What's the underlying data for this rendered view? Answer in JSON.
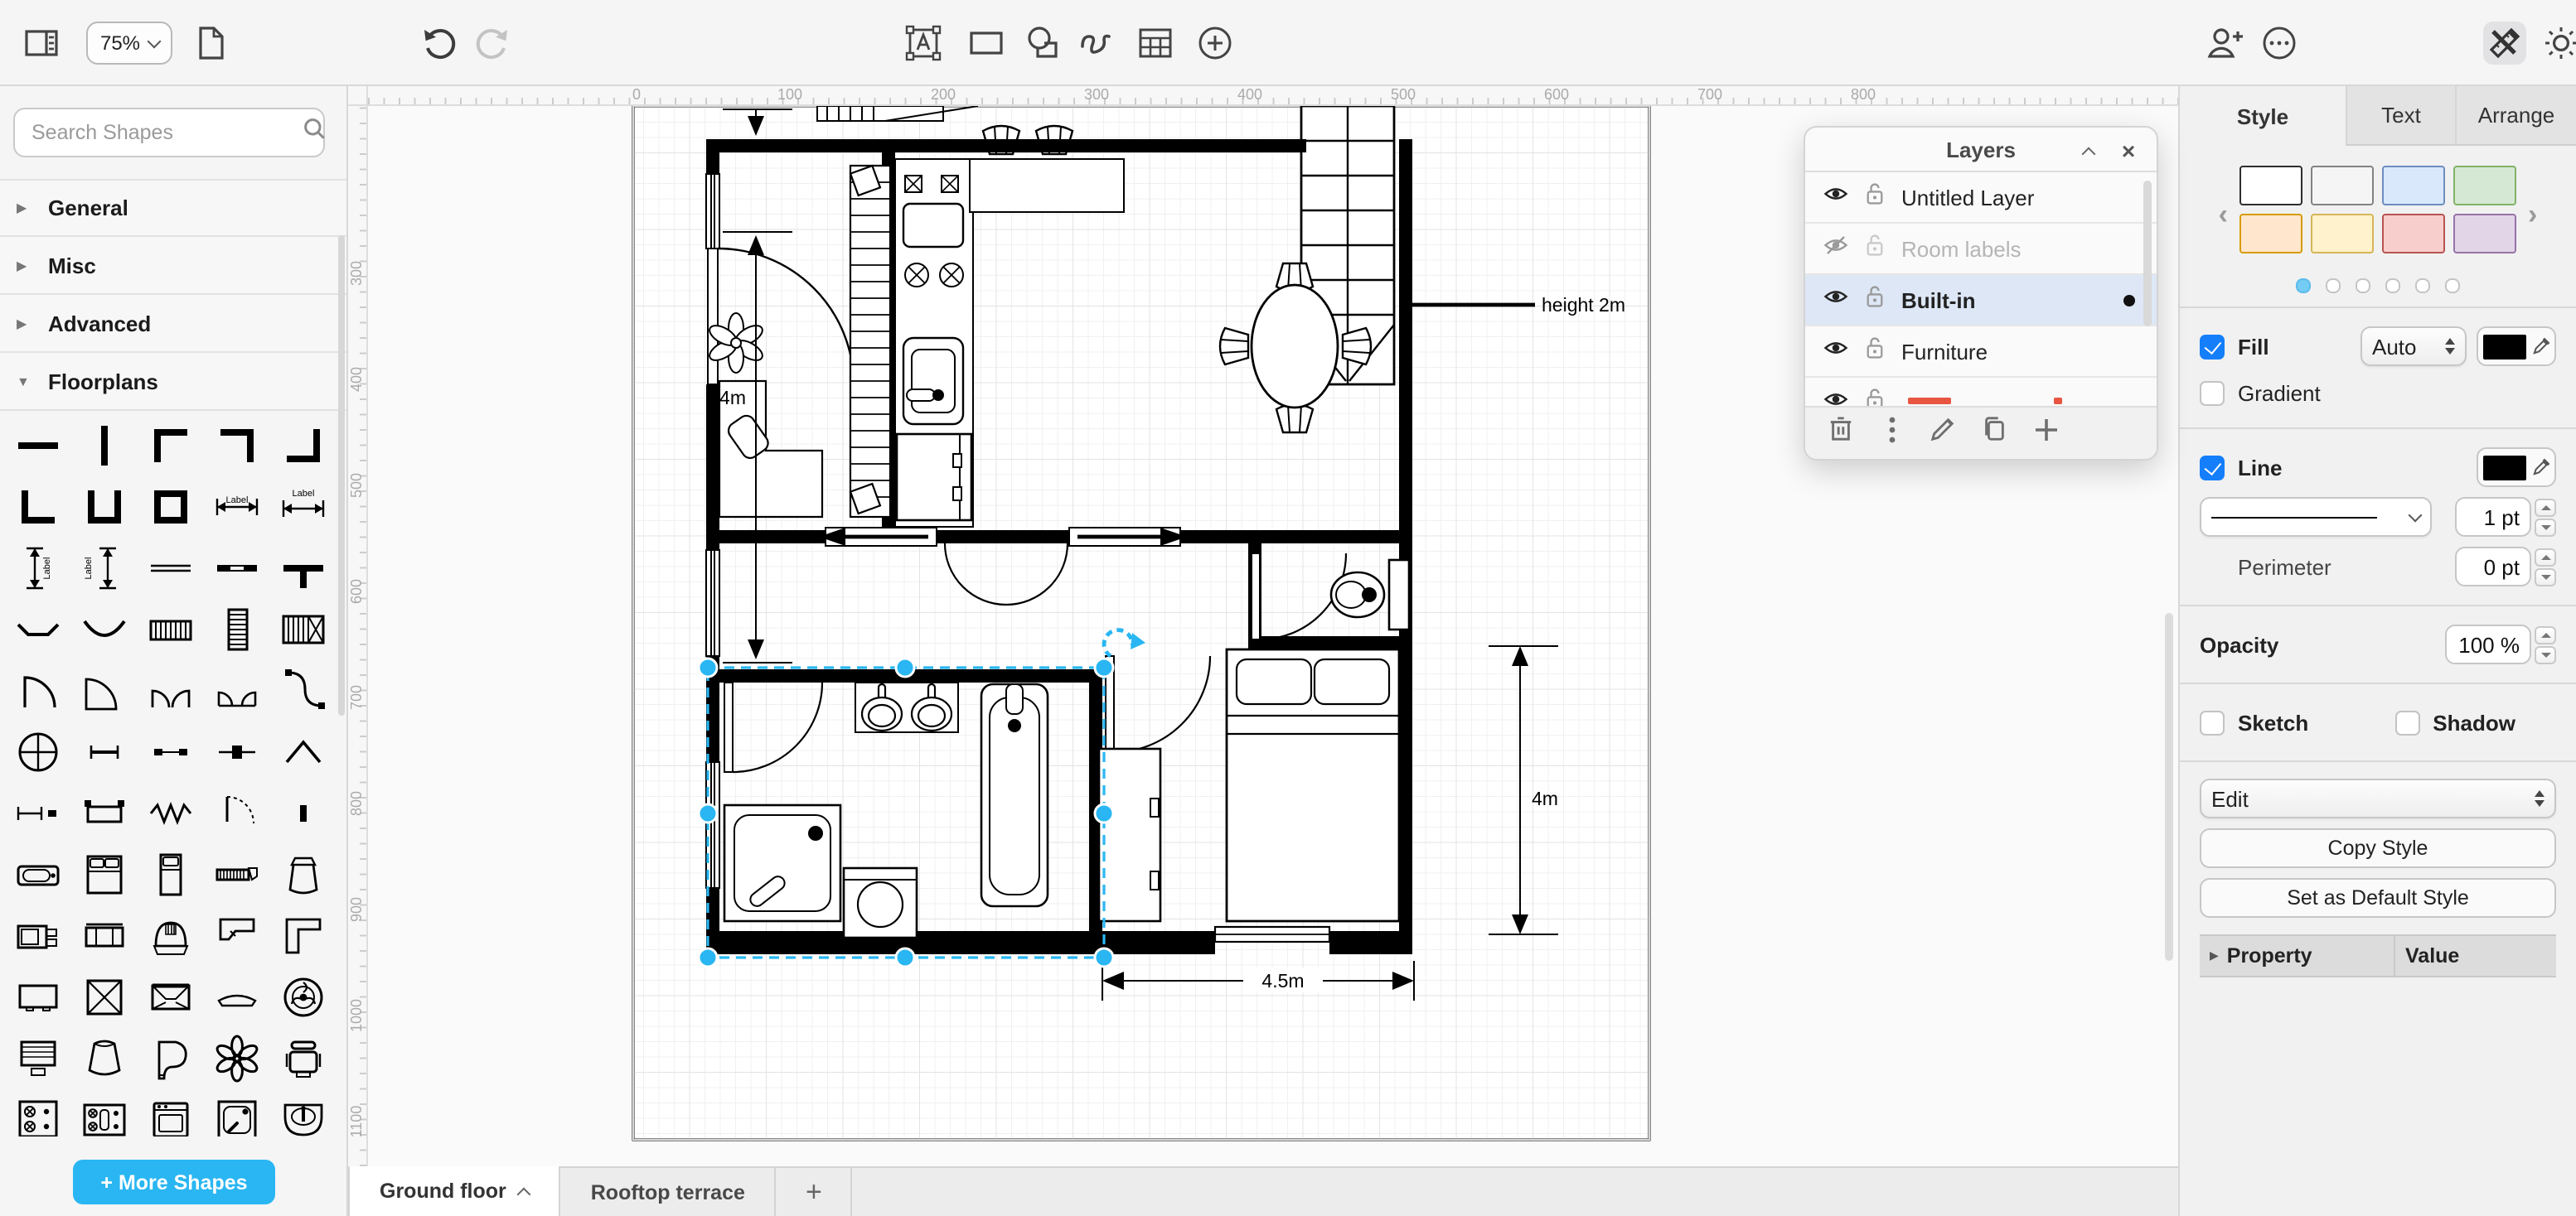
{
  "accent_color": "#29b6f2",
  "toolbar": {
    "zoom_value": "75%",
    "icons": [
      "sidebar-toggle",
      "page",
      "undo",
      "redo",
      "text-tool",
      "rectangle-tool",
      "shapes-tool",
      "freehand-tool",
      "table-tool",
      "insert-plus",
      "share",
      "more-options",
      "design-tools",
      "theme-sun"
    ]
  },
  "sidebar": {
    "search_placeholder": "Search Shapes",
    "shape_label_text": "Label",
    "sections": [
      {
        "label": "General",
        "expanded": false
      },
      {
        "label": "Misc",
        "expanded": false
      },
      {
        "label": "Advanced",
        "expanded": false
      },
      {
        "label": "Floorplans",
        "expanded": true
      }
    ],
    "shapes": [
      "wall",
      "wall-vertical",
      "wall-corner-nw",
      "wall-corner-ne",
      "wall-corner-se",
      "wall-corner-sw",
      "wall-u",
      "wall-square",
      "dimension",
      "dimension-top",
      "dimension-vertical",
      "dimension-vertical-2",
      "window",
      "wall-opening",
      "wall-tee",
      "curve-wall",
      "curve-wall-2",
      "stairs",
      "stairs-vertical",
      "stairs-landing",
      "door",
      "door-wide",
      "door-double",
      "door-double-2",
      "door-bifold",
      "column-circle",
      "window-short",
      "window-sill",
      "window-mid",
      "roof-gable",
      "dimension-small",
      "bench",
      "heater-zigzag",
      "door-quarter",
      "wall-stub",
      "bathtub",
      "bed-double",
      "bed-single",
      "tape-measure",
      "floor-lamp",
      "tv-cabinet",
      "sofa",
      "range-hood",
      "counter-corner",
      "counter-corner-2",
      "flat-tv",
      "crossed-box",
      "home-theater",
      "coffee-table",
      "ceiling-fan",
      "laptop",
      "basket",
      "grand-piano",
      "plant",
      "office-chair",
      "gas-stove",
      "cooktop-double",
      "oven",
      "shower-tray",
      "wash-basin",
      "vanity-sink",
      "kitchen-counter",
      "wardrobe",
      "spiral-stairs",
      "desk"
    ],
    "more_shapes_label": "+ More Shapes"
  },
  "rulers": {
    "horizontal": [
      "0",
      "100",
      "200",
      "300",
      "400",
      "500",
      "600",
      "700",
      "800"
    ],
    "vertical": [
      "300",
      "400",
      "500",
      "600",
      "700",
      "800",
      "900",
      "1000",
      "1100"
    ]
  },
  "canvas": {
    "labels": {
      "dim_left": "4m",
      "dim_right": "4m",
      "dim_bottom": "4.5m",
      "height_note": "height 2m"
    }
  },
  "layers_dialog": {
    "title": "Layers",
    "items": [
      {
        "name": "Untitled Layer",
        "visible": true,
        "dimmed": false,
        "selected": false
      },
      {
        "name": "Room labels",
        "visible": false,
        "dimmed": true,
        "selected": false
      },
      {
        "name": "Built-in",
        "visible": true,
        "dimmed": false,
        "selected": true
      },
      {
        "name": "Furniture",
        "visible": true,
        "dimmed": false,
        "selected": false
      }
    ]
  },
  "format_panel": {
    "tabs": [
      "Style",
      "Text",
      "Arrange"
    ],
    "active_tab": "Style",
    "swatches": [
      {
        "fill": "#ffffff",
        "stroke": "#2d2d2d"
      },
      {
        "fill": "#f5f5f5",
        "stroke": "#838383"
      },
      {
        "fill": "#dae8fc",
        "stroke": "#6c8ebf"
      },
      {
        "fill": "#d5e8d4",
        "stroke": "#82b366"
      },
      {
        "fill": "#ffe6cc",
        "stroke": "#d79b00"
      },
      {
        "fill": "#fff2cc",
        "stroke": "#d6b656"
      },
      {
        "fill": "#f8cecc",
        "stroke": "#b85450"
      },
      {
        "fill": "#e1d5e7",
        "stroke": "#9673a6"
      }
    ],
    "fill_label": "Fill",
    "fill_mode": "Auto",
    "gradient_label": "Gradient",
    "line_label": "Line",
    "line_width": "1 pt",
    "perimeter_label": "Perimeter",
    "perimeter_value": "0 pt",
    "opacity_label": "Opacity",
    "opacity_value": "100 %",
    "sketch_label": "Sketch",
    "shadow_label": "Shadow",
    "edit_label": "Edit",
    "copy_style_label": "Copy Style",
    "set_default_label": "Set as Default Style",
    "property_header": "Property",
    "value_header": "Value"
  },
  "page_tabs": {
    "tabs": [
      "Ground floor",
      "Rooftop terrace"
    ],
    "active": "Ground floor",
    "add_label": "+"
  }
}
